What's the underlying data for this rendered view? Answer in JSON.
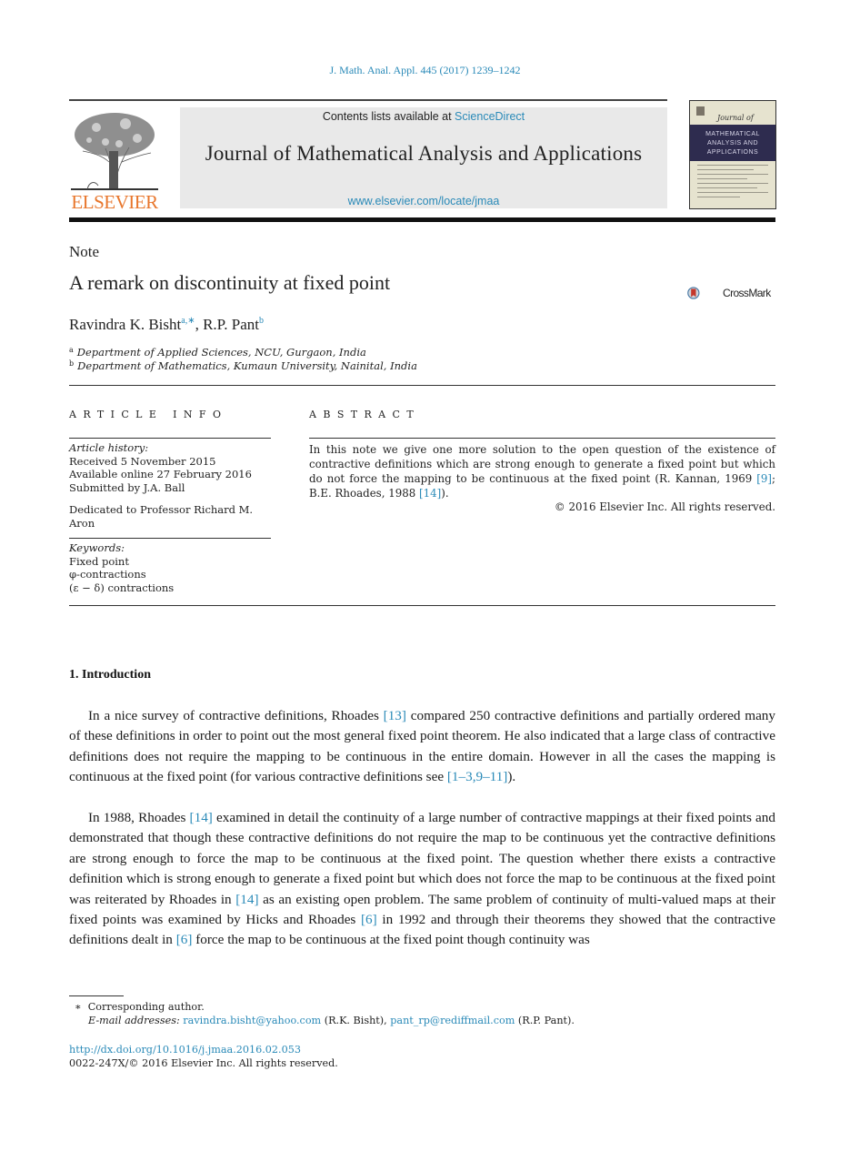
{
  "citation": "J. Math. Anal. Appl. 445 (2017) 1239–1242",
  "header": {
    "publisher_logo_text": "ELSEVIER",
    "contents_prefix": "Contents lists available at ",
    "contents_link": "ScienceDirect",
    "journal_title": "Journal of Mathematical Analysis and Applications",
    "journal_url": "www.elsevier.com/locate/jmaa",
    "cover": {
      "subtitle": "Journal of",
      "lines": [
        "MATHEMATICAL",
        "ANALYSIS AND",
        "APPLICATIONS"
      ]
    }
  },
  "article": {
    "type_label": "Note",
    "title": "A remark on discontinuity at fixed point",
    "crossmark_label": "CrossMark",
    "authors": [
      {
        "name": "Ravindra K. Bisht",
        "marks": "a,∗"
      },
      {
        "name": "R.P. Pant",
        "marks": "b"
      }
    ],
    "author_separator": ", ",
    "affiliations": [
      {
        "mark": "a",
        "text": "Department of Applied Sciences, NCU, Gurgaon, India"
      },
      {
        "mark": "b",
        "text": "Department of Mathematics, Kumaun University, Nainital, India"
      }
    ]
  },
  "article_info": {
    "heading": "ARTICLE INFO",
    "history_label": "Article history:",
    "history": [
      "Received 5 November 2015",
      "Available online 27 February 2016",
      "Submitted by J.A. Ball"
    ],
    "dedication": "Dedicated to Professor Richard M. Aron",
    "keywords_label": "Keywords:",
    "keywords": [
      "Fixed point",
      "φ-contractions",
      "(ε − δ) contractions"
    ]
  },
  "abstract": {
    "heading": "ABSTRACT",
    "text_1": "In this note we give one more solution to the open question of the existence of contractive definitions which are strong enough to generate a fixed point but which do not force the mapping to be continuous at the fixed point (R. Kannan, 1969 ",
    "ref_1": "[9]",
    "text_2": "; B.E. Rhoades, 1988 ",
    "ref_2": "[14]",
    "text_3": ").",
    "copyright": "© 2016 Elsevier Inc. All rights reserved."
  },
  "body": {
    "section_heading": "1.  Introduction",
    "para_1": {
      "t1": "In a nice survey of contractive definitions, Rhoades ",
      "r1": "[13]",
      "t2": " compared 250 contractive definitions and partially ordered many of these definitions in order to point out the most general fixed point theorem. He also indicated that a large class of contractive definitions does not require the mapping to be continuous in the entire domain. However in all the cases the mapping is continuous at the fixed point (for various contractive definitions see ",
      "r2": "[1–3,9–11]",
      "t3": ")."
    },
    "para_2": {
      "t1": "In 1988, Rhoades ",
      "r1": "[14]",
      "t2": " examined in detail the continuity of a large number of contractive mappings at their fixed points and demonstrated that though these contractive definitions do not require the map to be continuous yet the contractive definitions are strong enough to force the map to be continuous at the fixed point. The question whether there exists a contractive definition which is strong enough to generate a fixed point but which does not force the map to be continuous at the fixed point was reiterated by Rhoades in ",
      "r2": "[14]",
      "t3": " as an existing open problem. The same problem of continuity of multi-valued maps at their fixed points was examined by Hicks and Rhoades ",
      "r3": "[6]",
      "t4": " in 1992 and through their theorems they showed that the contractive definitions dealt in ",
      "r4": "[6]",
      "t5": " force the map to be continuous at the fixed point though continuity was"
    }
  },
  "footnotes": {
    "corresponding_mark": "∗",
    "corresponding": "Corresponding author.",
    "email_label": "E-mail addresses:",
    "email_1": "ravindra.bisht@yahoo.com",
    "email_1_owner": " (R.K. Bisht), ",
    "email_2": "pant_rp@rediffmail.com",
    "email_2_owner": " (R.P. Pant).",
    "doi": "http://dx.doi.org/10.1016/j.jmaa.2016.02.053",
    "issn": "0022-247X/© 2016 Elsevier Inc. All rights reserved."
  },
  "colors": {
    "link": "#2a8ab8",
    "elsevier_orange": "#e8762c",
    "banner_bg": "#e9e9e9",
    "cover_band": "#2e2c4f"
  }
}
